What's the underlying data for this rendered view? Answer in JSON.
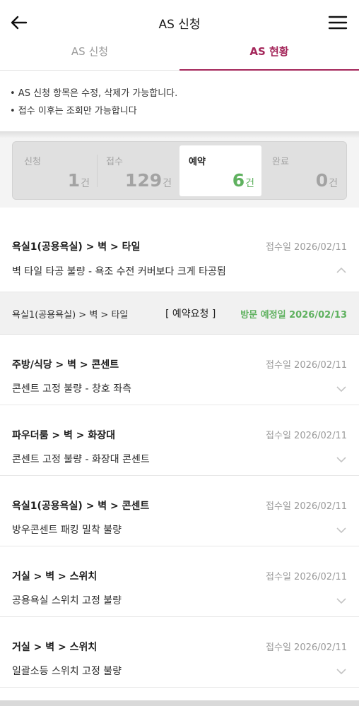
{
  "appbar": {
    "title": "AS 신청",
    "back_icon": "arrow-left-icon",
    "menu_icon": "hamburger-menu-icon"
  },
  "tabs": [
    {
      "label": "AS 신청",
      "active": false
    },
    {
      "label": "AS 현황",
      "active": true
    }
  ],
  "accent_color": "#a4265a",
  "highlight_color": "#5fb15f",
  "notice": [
    "• AS 신청 항목은 수정, 삭제가 가능합니다.",
    "• 접수 이후는 조회만 가능합니다"
  ],
  "summary": [
    {
      "label": "신청",
      "count": "1",
      "unit": "건",
      "active": false
    },
    {
      "label": "접수",
      "count": "129",
      "unit": "건",
      "active": false
    },
    {
      "label": "예약",
      "count": "6",
      "unit": "건",
      "active": true
    },
    {
      "label": "완료",
      "count": "0",
      "unit": "건",
      "active": false
    }
  ],
  "items": [
    {
      "path": "욕실1(공용욕실) > 벽 > 타일",
      "date": "접수일 2026/02/11",
      "desc": "벽 타일 타공 불량 - 욕조 수전 커버보다 크게 타공됨",
      "expanded": true,
      "detail": {
        "path": "욕실1(공용욕실) > 벽 > 타일",
        "status": "[ 예약요청 ]",
        "visit": "방문 예정일 2026/02/13"
      }
    },
    {
      "path": "주방/식당 > 벽 > 콘센트",
      "date": "접수일 2026/02/11",
      "desc": "콘센트 고정 불량 - 창호 좌측",
      "expanded": false
    },
    {
      "path": "파우더룸 > 벽 > 화장대",
      "date": "접수일 2026/02/11",
      "desc": "콘센트 고정 불량 - 화장대 콘센트",
      "expanded": false
    },
    {
      "path": "욕실1(공용욕실) > 벽 > 콘센트",
      "date": "접수일 2026/02/11",
      "desc": "방우콘센트 패킹 밀착 불량",
      "expanded": false
    },
    {
      "path": "거실 > 벽 > 스위치",
      "date": "접수일 2026/02/11",
      "desc": "공용욕실 스위치 고정 불량",
      "expanded": false
    },
    {
      "path": "거실 > 벽 > 스위치",
      "date": "접수일 2026/02/11",
      "desc": "일괄소등 스위치 고정 불량",
      "expanded": false
    }
  ]
}
